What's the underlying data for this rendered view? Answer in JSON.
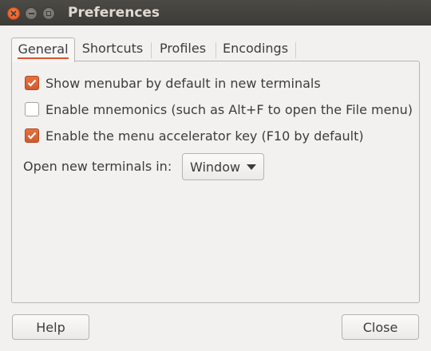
{
  "window": {
    "title": "Preferences",
    "close_icon": "close-icon",
    "minimize_icon": "minimize-icon",
    "maximize_icon": "maximize-icon"
  },
  "tabs": [
    {
      "label": "General",
      "active": true
    },
    {
      "label": "Shortcuts",
      "active": false
    },
    {
      "label": "Profiles",
      "active": false
    },
    {
      "label": "Encodings",
      "active": false
    }
  ],
  "general": {
    "options": [
      {
        "label": "Show menubar by default in new terminals",
        "checked": true
      },
      {
        "label": "Enable mnemonics (such as Alt+F to open the File menu)",
        "checked": false
      },
      {
        "label": "Enable the menu accelerator key (F10 by default)",
        "checked": true
      }
    ],
    "open_new_label": "Open new terminals in:",
    "open_new_value": "Window"
  },
  "buttons": {
    "help": "Help",
    "close": "Close"
  },
  "colors": {
    "accent": "#e0532b",
    "titlebar": "#3c3b37",
    "window_bg": "#f2f1f0"
  }
}
